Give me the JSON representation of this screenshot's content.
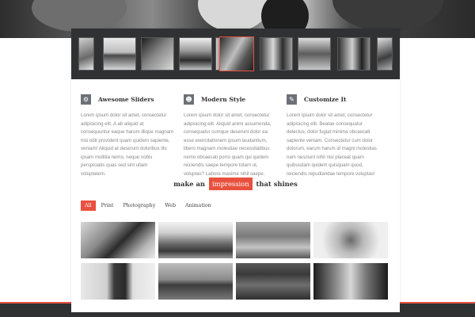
{
  "filmstrip": {
    "count": 10,
    "active_index": 4
  },
  "features": [
    {
      "title": "Awesome Sliders",
      "icon": "gear-icon",
      "text": "Lorem ipsum dolor sit amet, consectetur\nadipisicing elit. A ab aliquid at\nconsequuntur eaque harum illique magnam\nnisi odit provident quam quidem sapiente,\nveniam! Aliquid at deserunt doloribus illo\nipsam mollitia nemo, neque nobis\nperspiciatis quas sed sint ullam\nvoluptatem."
    },
    {
      "title": "Modern Style",
      "icon": "person-icon",
      "text": "Lorem ipsum dolor sit amet, consectetur\nadipisicing elit. Aliquid animi assumenda,\nconsequatur cumque deserunt dolor ea\nesse exercitationem ipsum laudantium,\nlibero magnam molestiae necessitatibus\nnemo obcaecati porro quam qui quidem\nreiciendis saepe tempore totam ut,\nvoluptas? Labore maxime nihil saepe."
    },
    {
      "title": "Customize It",
      "icon": "pencil-icon",
      "text": "Lorem ipsum dolor sit amet, consectetur\nadipisicing elit. Beatae consequatur\ndelectus, dolor fugiat minima obcaecati\nsapiente veniam. Consectetur cum dolor\ndolorum, earum harum id magni molestias\nnam nesciunt nihil nisi placeat quam\nquibusdam quidem quisquam quod,\nreiciendis repudiandae tempore voluptas!"
    }
  ],
  "tagline": {
    "before": "make an",
    "highlight": "impression",
    "after": "that shines"
  },
  "filters": [
    "All",
    "Print",
    "Photography",
    "Web",
    "Animation"
  ],
  "active_filter": "All",
  "colors": {
    "accent": "#e8513e",
    "dark": "#2f3133",
    "icon_bg": "#6c7177"
  }
}
